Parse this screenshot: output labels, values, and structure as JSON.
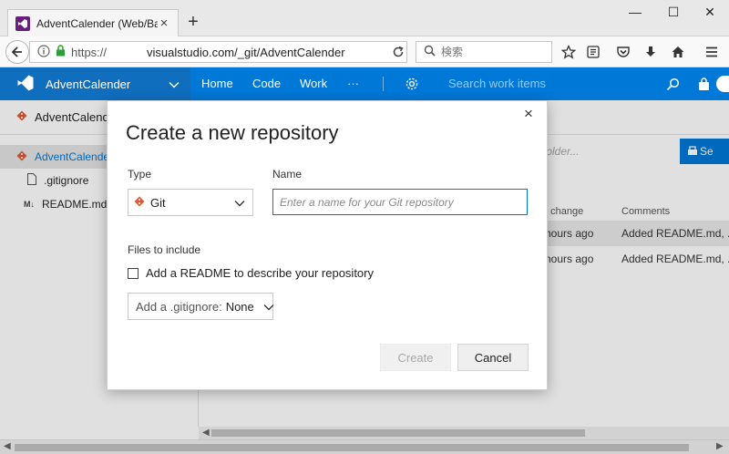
{
  "browser": {
    "tab_title": "AdventCalender (Web/Bac…",
    "tab_close": "×",
    "new_tab": "+",
    "window_controls": [
      "—",
      "☐",
      "✕"
    ],
    "url_scheme": "https://",
    "url_domain": "visualstudio.com/_git/AdventCalender",
    "search_placeholder": "検索",
    "icons": [
      "back-arrow-icon",
      "info-icon",
      "lock-icon",
      "reload-icon",
      "search-icon",
      "star-icon",
      "reading-list-icon",
      "pocket-icon",
      "download-icon",
      "home-icon",
      "menu-icon"
    ]
  },
  "header": {
    "project": "AdventCalender",
    "hubs": [
      "Home",
      "Code",
      "Work",
      "···"
    ],
    "search_placeholder": "Search work items",
    "brand_color": "#0078d7"
  },
  "background": {
    "breadcrumb": "AdventCalender",
    "tree": [
      {
        "label": "AdventCalender",
        "selected": true
      },
      {
        "label": ".gitignore",
        "selected": false
      },
      {
        "label": "README.md",
        "selected": false
      }
    ],
    "folder_placeholder": "folder...",
    "set_button": "Se",
    "columns": [
      "t change",
      "Comments"
    ],
    "rows": [
      {
        "change": "hours ago",
        "comment": "Added README.md, .gi"
      },
      {
        "change": "hours ago",
        "comment": "Added README.md, .gi"
      }
    ]
  },
  "dialog": {
    "title": "Create a new repository",
    "close": "×",
    "type_label": "Type",
    "type_value": "Git",
    "name_label": "Name",
    "name_placeholder": "Enter a name for your Git repository",
    "files_label": "Files to include",
    "readme_label": "Add a README to describe your repository",
    "readme_checked": false,
    "gitignore_label": "Add a .gitignore:",
    "gitignore_value": "None",
    "create_button": "Create",
    "cancel_button": "Cancel"
  }
}
